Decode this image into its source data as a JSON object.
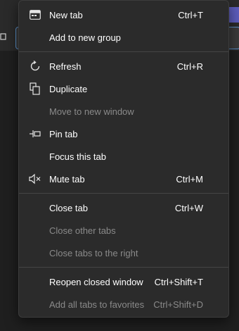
{
  "menu": {
    "items": [
      {
        "label": "New tab",
        "shortcut": "Ctrl+T",
        "icon": "new-tab-icon",
        "enabled": true
      },
      {
        "label": "Add to new group",
        "shortcut": "",
        "icon": "",
        "enabled": true
      },
      {
        "label": "Refresh",
        "shortcut": "Ctrl+R",
        "icon": "refresh-icon",
        "enabled": true
      },
      {
        "label": "Duplicate",
        "shortcut": "",
        "icon": "duplicate-icon",
        "enabled": true
      },
      {
        "label": "Move to new window",
        "shortcut": "",
        "icon": "",
        "enabled": false
      },
      {
        "label": "Pin tab",
        "shortcut": "",
        "icon": "pin-icon",
        "enabled": true
      },
      {
        "label": "Focus this tab",
        "shortcut": "",
        "icon": "",
        "enabled": true
      },
      {
        "label": "Mute tab",
        "shortcut": "Ctrl+M",
        "icon": "mute-icon",
        "enabled": true
      },
      {
        "label": "Close tab",
        "shortcut": "Ctrl+W",
        "icon": "",
        "enabled": true
      },
      {
        "label": "Close other tabs",
        "shortcut": "",
        "icon": "",
        "enabled": false
      },
      {
        "label": "Close tabs to the right",
        "shortcut": "",
        "icon": "",
        "enabled": false
      },
      {
        "label": "Reopen closed window",
        "shortcut": "Ctrl+Shift+T",
        "icon": "",
        "enabled": true
      },
      {
        "label": "Add all tabs to favorites",
        "shortcut": "Ctrl+Shift+D",
        "icon": "",
        "enabled": false
      }
    ]
  },
  "colors": {
    "menu_background": "#2b2b2b",
    "text": "#ffffff",
    "disabled_text": "#8a8a8a",
    "separator": "#454545",
    "active_tab_border": "#5a8fc8",
    "accent": "#5c5cbc"
  }
}
